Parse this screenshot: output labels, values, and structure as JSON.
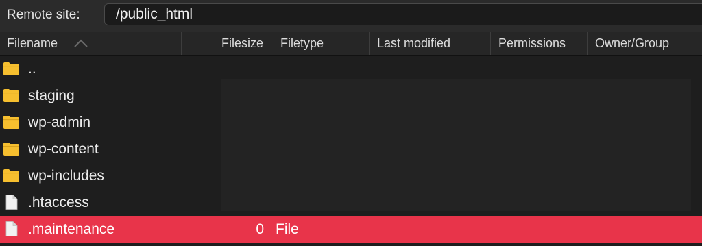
{
  "remote": {
    "label": "Remote site:",
    "path": "/public_html"
  },
  "columns": {
    "filename": "Filename",
    "filesize": "Filesize",
    "filetype": "Filetype",
    "last_modified": "Last modified",
    "permissions": "Permissions",
    "owner_group": "Owner/Group"
  },
  "sort": {
    "column": "Filename",
    "direction": "ascending",
    "icon": "chevron-up-icon"
  },
  "files": [
    {
      "name": "..",
      "icon": "folder-icon",
      "size": "",
      "type": ""
    },
    {
      "name": "staging",
      "icon": "folder-icon",
      "size": "",
      "type": ""
    },
    {
      "name": "wp-admin",
      "icon": "folder-icon",
      "size": "",
      "type": ""
    },
    {
      "name": "wp-content",
      "icon": "folder-icon",
      "size": "",
      "type": ""
    },
    {
      "name": "wp-includes",
      "icon": "folder-icon",
      "size": "",
      "type": ""
    },
    {
      "name": ".htaccess",
      "icon": "file-icon",
      "size": "",
      "type": ""
    },
    {
      "name": ".maintenance",
      "icon": "file-icon",
      "size": "0",
      "type": "File",
      "selected": true
    }
  ],
  "colors": {
    "selection": "#e8344a",
    "folder": "#f6bf2f",
    "background": "#1e1e1e"
  }
}
